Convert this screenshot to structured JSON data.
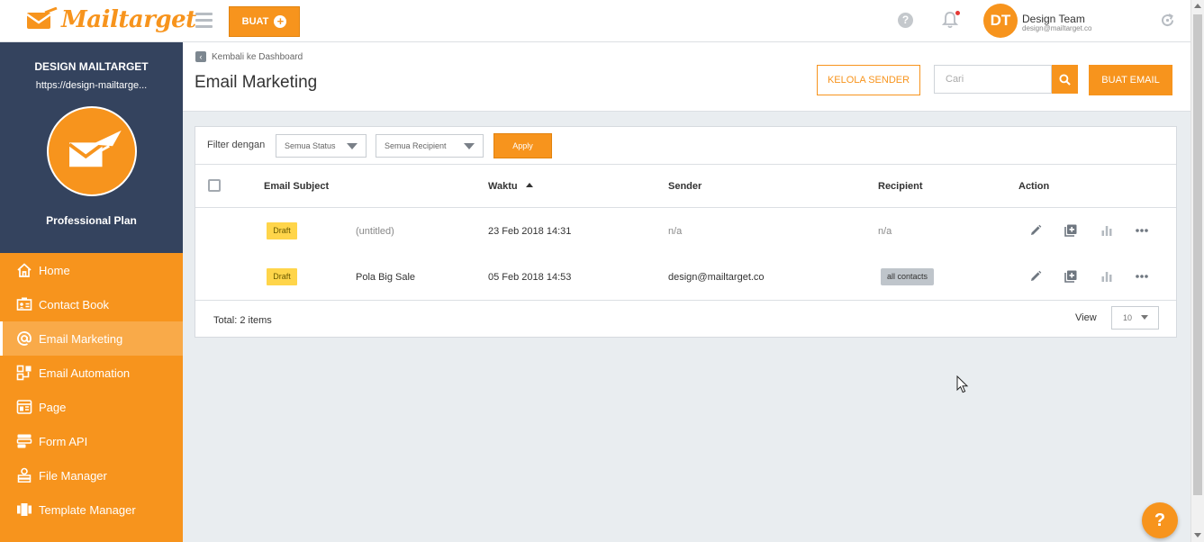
{
  "brand": {
    "name": "Mailtarget",
    "accent": "#f7941d",
    "sidebar_dark": "#34435e"
  },
  "topbar": {
    "create_label": "BUAT",
    "help_symbol": "?",
    "user": {
      "initials": "DT",
      "name": "Design Team",
      "email": "design@mailtarget.co"
    }
  },
  "sidebar": {
    "account_name": "DESIGN MAILTARGET",
    "account_url": "https://design-mailtarge...",
    "plan": "Professional Plan",
    "items": [
      {
        "label": "Home",
        "icon": "home-icon",
        "active": false
      },
      {
        "label": "Contact Book",
        "icon": "contact-card-icon",
        "active": false
      },
      {
        "label": "Email Marketing",
        "icon": "at-sign-icon",
        "active": true
      },
      {
        "label": "Email Automation",
        "icon": "automation-icon",
        "active": false
      },
      {
        "label": "Page",
        "icon": "page-icon",
        "active": false
      },
      {
        "label": "Form API",
        "icon": "form-icon",
        "active": false
      },
      {
        "label": "File Manager",
        "icon": "file-manager-icon",
        "active": false
      },
      {
        "label": "Template Manager",
        "icon": "template-icon",
        "active": false
      }
    ]
  },
  "header": {
    "back_label": "Kembali ke Dashboard",
    "title": "Email Marketing",
    "kelola_label": "KELOLA SENDER",
    "search_placeholder": "Cari",
    "create_email_label": "BUAT EMAIL"
  },
  "filter": {
    "label": "Filter dengan",
    "status_value": "Semua Status",
    "recipient_value": "Semua Recipient",
    "apply_label": "Apply"
  },
  "table": {
    "columns": [
      "Email Subject",
      "Waktu",
      "Sender",
      "Recipient",
      "Action"
    ],
    "rows": [
      {
        "status": "Draft",
        "subject": "(untitled)",
        "time": "23 Feb 2018 14:31",
        "sender": "n/a",
        "recipient": "n/a",
        "recipient_is_tag": false
      },
      {
        "status": "Draft",
        "subject": "Pola Big Sale",
        "time": "05 Feb 2018 14:53",
        "sender": "design@mailtarget.co",
        "recipient": "all contacts",
        "recipient_is_tag": true
      }
    ]
  },
  "footer": {
    "total": "Total: 2 items",
    "view_label": "View",
    "page_size": "10"
  },
  "help_fab": "?"
}
